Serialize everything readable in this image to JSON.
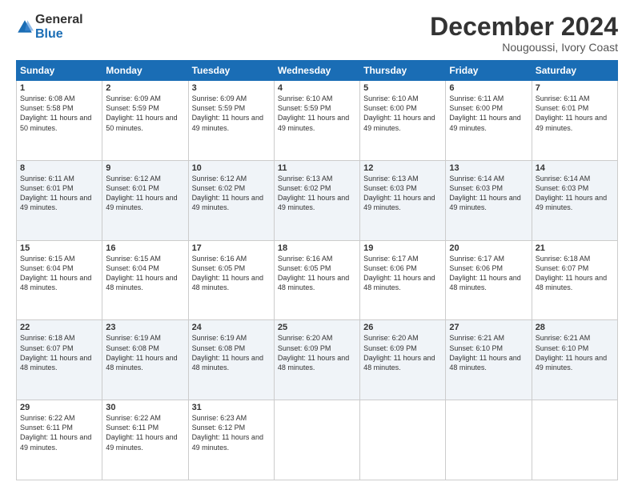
{
  "logo": {
    "general": "General",
    "blue": "Blue"
  },
  "title": "December 2024",
  "subtitle": "Nougoussi, Ivory Coast",
  "days_header": [
    "Sunday",
    "Monday",
    "Tuesday",
    "Wednesday",
    "Thursday",
    "Friday",
    "Saturday"
  ],
  "weeks": [
    [
      {
        "day": "1",
        "sunrise": "6:08 AM",
        "sunset": "5:58 PM",
        "daylight": "11 hours and 50 minutes."
      },
      {
        "day": "2",
        "sunrise": "6:09 AM",
        "sunset": "5:59 PM",
        "daylight": "11 hours and 50 minutes."
      },
      {
        "day": "3",
        "sunrise": "6:09 AM",
        "sunset": "5:59 PM",
        "daylight": "11 hours and 49 minutes."
      },
      {
        "day": "4",
        "sunrise": "6:10 AM",
        "sunset": "5:59 PM",
        "daylight": "11 hours and 49 minutes."
      },
      {
        "day": "5",
        "sunrise": "6:10 AM",
        "sunset": "6:00 PM",
        "daylight": "11 hours and 49 minutes."
      },
      {
        "day": "6",
        "sunrise": "6:11 AM",
        "sunset": "6:00 PM",
        "daylight": "11 hours and 49 minutes."
      },
      {
        "day": "7",
        "sunrise": "6:11 AM",
        "sunset": "6:01 PM",
        "daylight": "11 hours and 49 minutes."
      }
    ],
    [
      {
        "day": "8",
        "sunrise": "6:11 AM",
        "sunset": "6:01 PM",
        "daylight": "11 hours and 49 minutes."
      },
      {
        "day": "9",
        "sunrise": "6:12 AM",
        "sunset": "6:01 PM",
        "daylight": "11 hours and 49 minutes."
      },
      {
        "day": "10",
        "sunrise": "6:12 AM",
        "sunset": "6:02 PM",
        "daylight": "11 hours and 49 minutes."
      },
      {
        "day": "11",
        "sunrise": "6:13 AM",
        "sunset": "6:02 PM",
        "daylight": "11 hours and 49 minutes."
      },
      {
        "day": "12",
        "sunrise": "6:13 AM",
        "sunset": "6:03 PM",
        "daylight": "11 hours and 49 minutes."
      },
      {
        "day": "13",
        "sunrise": "6:14 AM",
        "sunset": "6:03 PM",
        "daylight": "11 hours and 49 minutes."
      },
      {
        "day": "14",
        "sunrise": "6:14 AM",
        "sunset": "6:03 PM",
        "daylight": "11 hours and 49 minutes."
      }
    ],
    [
      {
        "day": "15",
        "sunrise": "6:15 AM",
        "sunset": "6:04 PM",
        "daylight": "11 hours and 48 minutes."
      },
      {
        "day": "16",
        "sunrise": "6:15 AM",
        "sunset": "6:04 PM",
        "daylight": "11 hours and 48 minutes."
      },
      {
        "day": "17",
        "sunrise": "6:16 AM",
        "sunset": "6:05 PM",
        "daylight": "11 hours and 48 minutes."
      },
      {
        "day": "18",
        "sunrise": "6:16 AM",
        "sunset": "6:05 PM",
        "daylight": "11 hours and 48 minutes."
      },
      {
        "day": "19",
        "sunrise": "6:17 AM",
        "sunset": "6:06 PM",
        "daylight": "11 hours and 48 minutes."
      },
      {
        "day": "20",
        "sunrise": "6:17 AM",
        "sunset": "6:06 PM",
        "daylight": "11 hours and 48 minutes."
      },
      {
        "day": "21",
        "sunrise": "6:18 AM",
        "sunset": "6:07 PM",
        "daylight": "11 hours and 48 minutes."
      }
    ],
    [
      {
        "day": "22",
        "sunrise": "6:18 AM",
        "sunset": "6:07 PM",
        "daylight": "11 hours and 48 minutes."
      },
      {
        "day": "23",
        "sunrise": "6:19 AM",
        "sunset": "6:08 PM",
        "daylight": "11 hours and 48 minutes."
      },
      {
        "day": "24",
        "sunrise": "6:19 AM",
        "sunset": "6:08 PM",
        "daylight": "11 hours and 48 minutes."
      },
      {
        "day": "25",
        "sunrise": "6:20 AM",
        "sunset": "6:09 PM",
        "daylight": "11 hours and 48 minutes."
      },
      {
        "day": "26",
        "sunrise": "6:20 AM",
        "sunset": "6:09 PM",
        "daylight": "11 hours and 48 minutes."
      },
      {
        "day": "27",
        "sunrise": "6:21 AM",
        "sunset": "6:10 PM",
        "daylight": "11 hours and 48 minutes."
      },
      {
        "day": "28",
        "sunrise": "6:21 AM",
        "sunset": "6:10 PM",
        "daylight": "11 hours and 49 minutes."
      }
    ],
    [
      {
        "day": "29",
        "sunrise": "6:22 AM",
        "sunset": "6:11 PM",
        "daylight": "11 hours and 49 minutes."
      },
      {
        "day": "30",
        "sunrise": "6:22 AM",
        "sunset": "6:11 PM",
        "daylight": "11 hours and 49 minutes."
      },
      {
        "day": "31",
        "sunrise": "6:23 AM",
        "sunset": "6:12 PM",
        "daylight": "11 hours and 49 minutes."
      },
      null,
      null,
      null,
      null
    ]
  ]
}
